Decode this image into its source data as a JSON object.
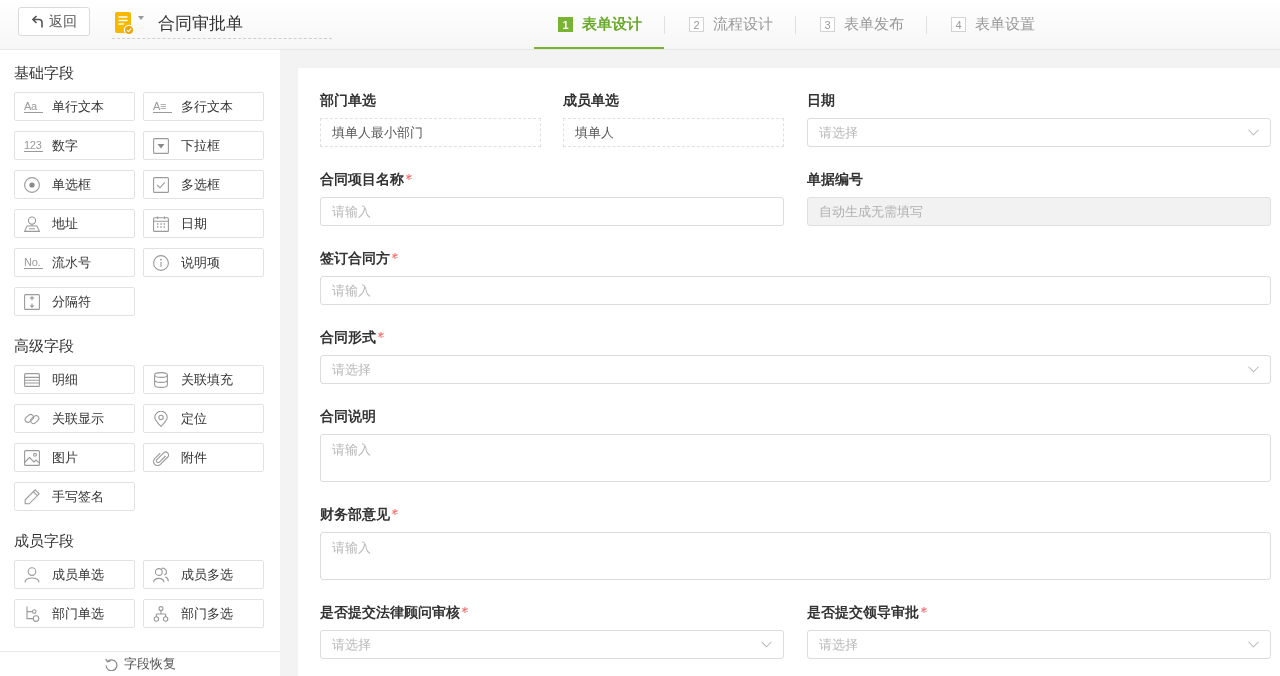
{
  "top_bar": {
    "back_button": "返回",
    "title": "合同审批单",
    "steps": [
      {
        "number": "1",
        "label": "表单设计",
        "selected": true
      },
      {
        "number": "2",
        "label": "流程设计",
        "selected": false
      },
      {
        "number": "3",
        "label": "表单发布",
        "selected": false
      },
      {
        "number": "4",
        "label": "表单设置",
        "selected": false
      }
    ]
  },
  "sidebar": {
    "sections": [
      {
        "title": "基础字段",
        "items": [
          {
            "label": "单行文本",
            "kind": "text",
            "glyph": "Aa"
          },
          {
            "label": "多行文本",
            "kind": "textarea",
            "glyph": "A≡"
          },
          {
            "label": "数字",
            "kind": "number",
            "glyph": "123"
          },
          {
            "label": "下拉框",
            "kind": "dropdown"
          },
          {
            "label": "单选框",
            "kind": "radio"
          },
          {
            "label": "多选框",
            "kind": "checkbox"
          },
          {
            "label": "地址",
            "kind": "address"
          },
          {
            "label": "日期",
            "kind": "date"
          },
          {
            "label": "流水号",
            "kind": "serial",
            "glyph": "No."
          },
          {
            "label": "说明项",
            "kind": "note"
          },
          {
            "label": "分隔符",
            "kind": "divider"
          }
        ]
      },
      {
        "title": "高级字段",
        "items": [
          {
            "label": "明细",
            "kind": "table"
          },
          {
            "label": "关联填充",
            "kind": "lookup"
          },
          {
            "label": "关联显示",
            "kind": "link"
          },
          {
            "label": "定位",
            "kind": "location"
          },
          {
            "label": "图片",
            "kind": "image"
          },
          {
            "label": "附件",
            "kind": "file"
          },
          {
            "label": "手写签名",
            "kind": "signature"
          }
        ]
      },
      {
        "title": "成员字段",
        "items": [
          {
            "label": "成员单选",
            "kind": "member"
          },
          {
            "label": "成员多选",
            "kind": "members"
          },
          {
            "label": "部门单选",
            "kind": "dept"
          },
          {
            "label": "部门多选",
            "kind": "depts"
          }
        ]
      }
    ],
    "footer_button": "字段恢复"
  },
  "form": {
    "rows": [
      {
        "cells": [
          {
            "fields": [
              {
                "label": "部门单选",
                "required": false,
                "kind": "fixed",
                "value": "填单人最小部门",
                "disabled": false
              },
              {
                "label": "成员单选",
                "required": false,
                "kind": "fixed",
                "value": "填单人",
                "disabled": false
              }
            ]
          },
          {
            "fields": [
              {
                "label": "日期",
                "required": false,
                "kind": "select",
                "placeholder": "请选择",
                "disabled": false
              }
            ]
          }
        ]
      },
      {
        "cells": [
          {
            "fields": [
              {
                "label": "合同项目名称",
                "required": true,
                "kind": "input",
                "placeholder": "请输入",
                "disabled": false
              }
            ]
          },
          {
            "fields": [
              {
                "label": "单据编号",
                "required": false,
                "kind": "input",
                "placeholder": "自动生成无需填写",
                "disabled": true
              }
            ]
          }
        ]
      },
      {
        "cells": [
          {
            "fields": [
              {
                "label": "签订合同方",
                "required": true,
                "kind": "input",
                "placeholder": "请输入",
                "disabled": false
              }
            ]
          }
        ]
      },
      {
        "cells": [
          {
            "fields": [
              {
                "label": "合同形式",
                "required": true,
                "kind": "select",
                "placeholder": "请选择",
                "disabled": false
              }
            ]
          }
        ]
      },
      {
        "cells": [
          {
            "fields": [
              {
                "label": "合同说明",
                "required": false,
                "kind": "textarea",
                "placeholder": "请输入",
                "disabled": false
              }
            ]
          }
        ]
      },
      {
        "cells": [
          {
            "fields": [
              {
                "label": "财务部意见",
                "required": true,
                "kind": "textarea",
                "placeholder": "请输入",
                "disabled": false
              }
            ]
          }
        ]
      },
      {
        "cells": [
          {
            "fields": [
              {
                "label": "是否提交法律顾问审核",
                "required": true,
                "kind": "select",
                "placeholder": "请选择",
                "disabled": false
              }
            ]
          },
          {
            "fields": [
              {
                "label": "是否提交领导审批",
                "required": true,
                "kind": "select",
                "placeholder": "请选择",
                "disabled": false
              }
            ]
          }
        ]
      }
    ]
  }
}
